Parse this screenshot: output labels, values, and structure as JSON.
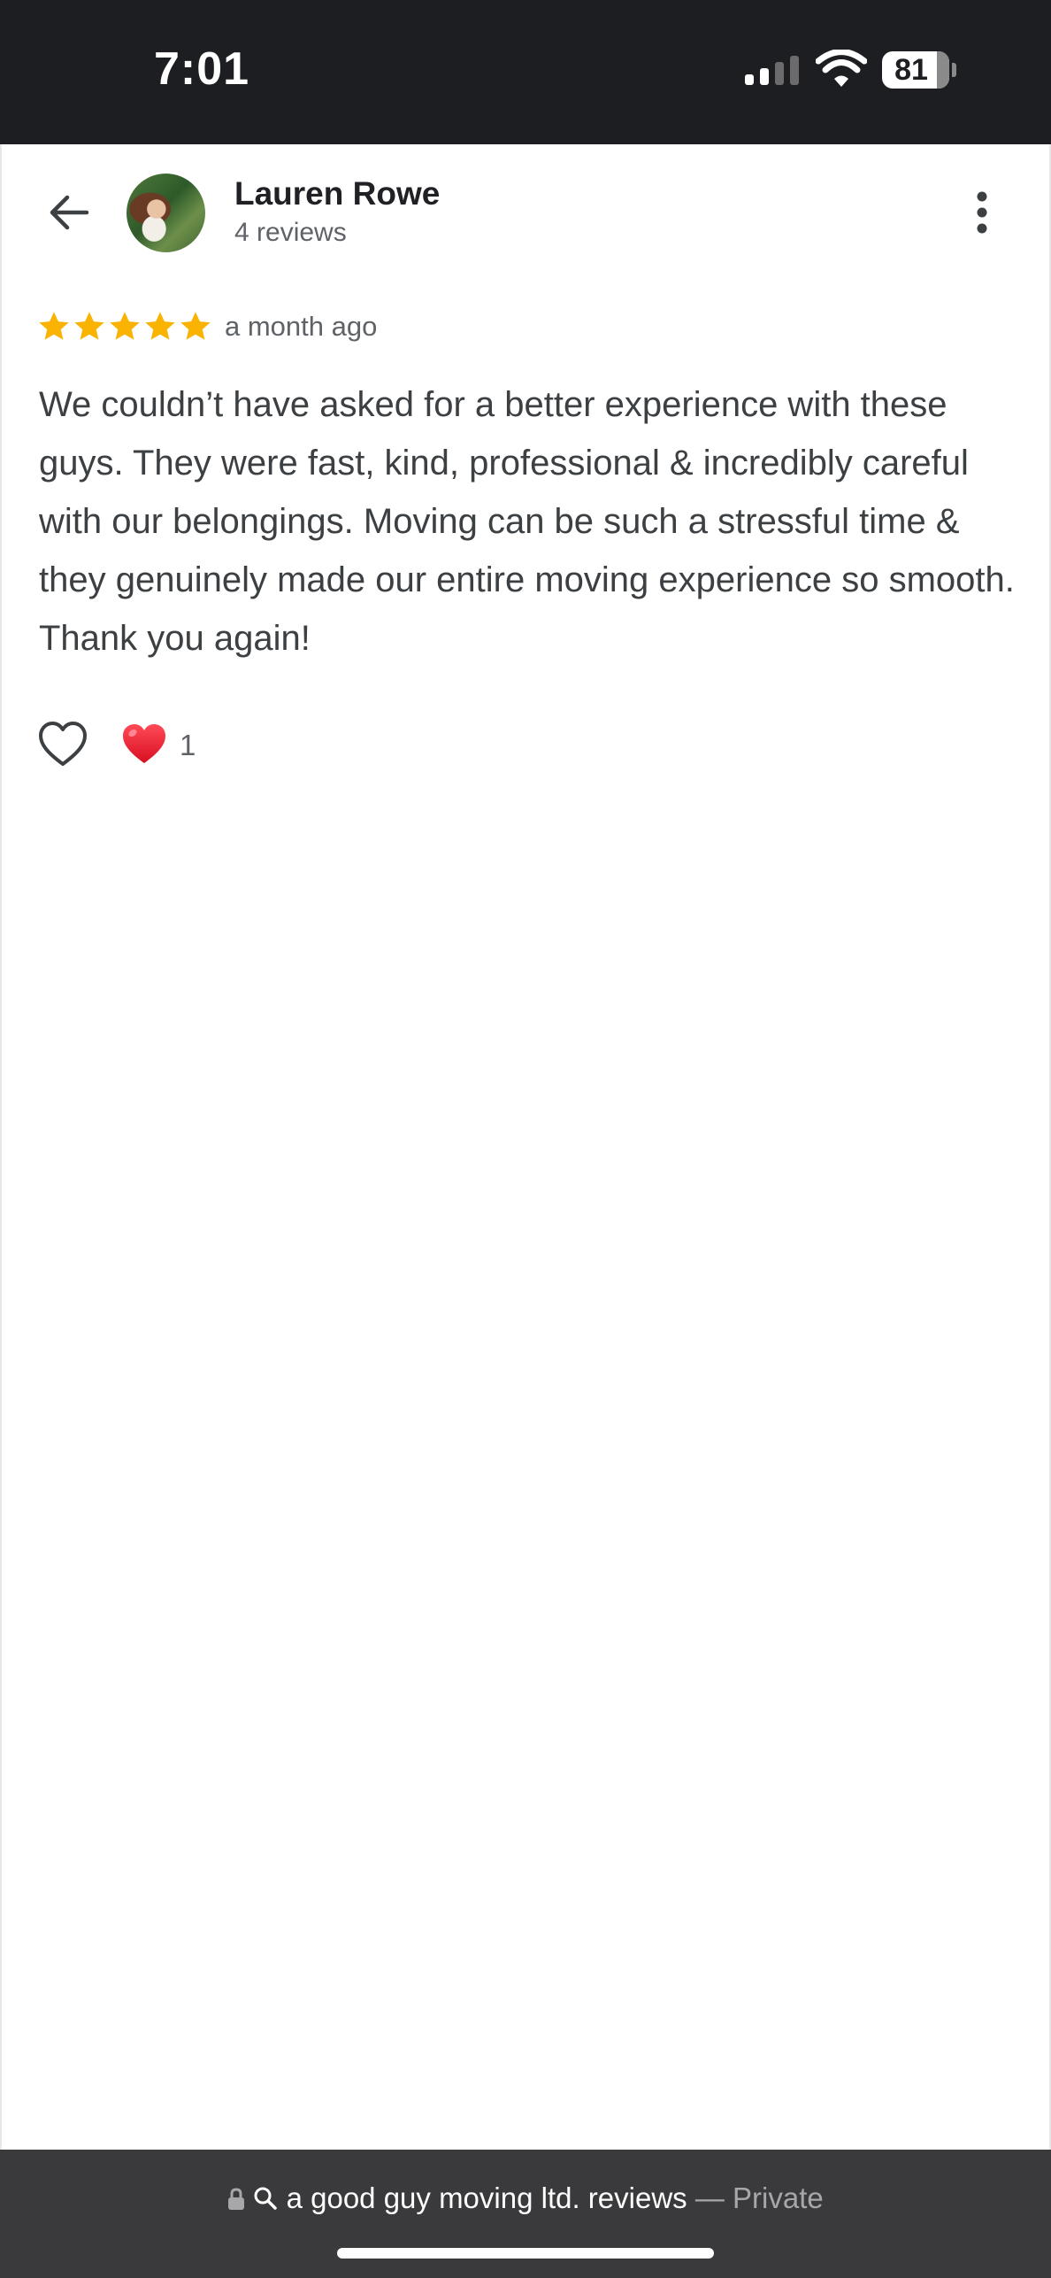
{
  "status_bar": {
    "time": "7:01",
    "battery": "81"
  },
  "header": {
    "reviewer_name": "Lauren Rowe",
    "review_count": "4 reviews"
  },
  "review": {
    "rating": 5,
    "rating_max": 5,
    "time": "a month ago",
    "text": "We couldn’t have asked for a better experience with these guys. They were fast, kind, professional & incredibly careful with our belongings. Moving can be such a stressful time & they genuinely made our entire moving experience so smooth. Thank you again!"
  },
  "reactions": {
    "heart_count": "1"
  },
  "browser": {
    "url_text": "a good guy moving ltd. reviews",
    "separator": "—",
    "mode": "Private"
  },
  "colors": {
    "star": "#F9B300",
    "heart": "#E8162B",
    "status_bar_bg": "#1D1E21",
    "bottom_bar_bg": "#3A3A3C"
  }
}
